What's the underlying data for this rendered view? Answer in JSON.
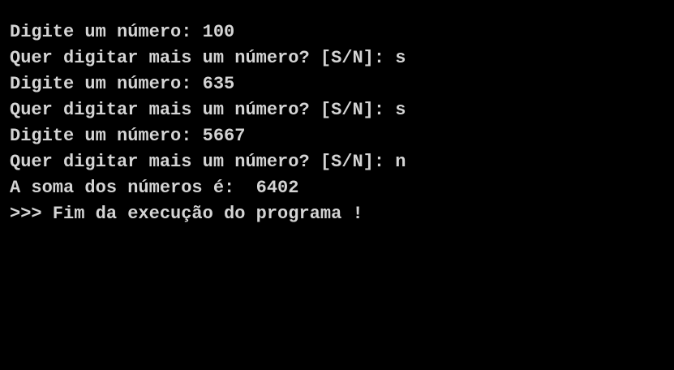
{
  "console": {
    "lines": [
      "Digite um número: 100",
      "Quer digitar mais um número? [S/N]: s",
      "Digite um número: 635",
      "Quer digitar mais um número? [S/N]: s",
      "Digite um número: 5667",
      "Quer digitar mais um número? [S/N]: n",
      "A soma dos números é:  6402",
      ">>> Fim da execução do programa !"
    ]
  },
  "colors": {
    "background": "#000000",
    "text": "#d4d4d4"
  }
}
